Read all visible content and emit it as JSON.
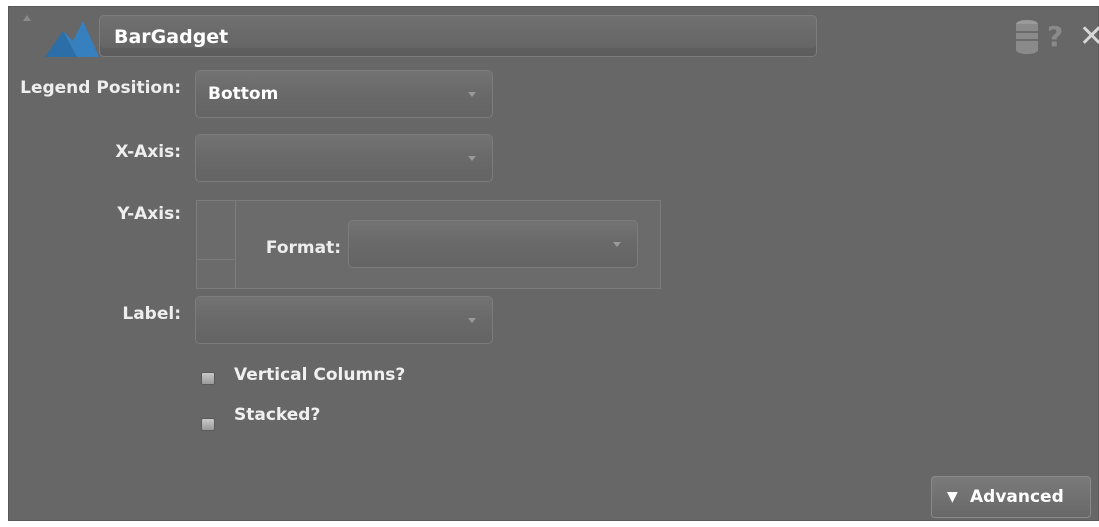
{
  "gadget": {
    "title": "BarGadget",
    "help_symbol": "?",
    "close_symbol": "✕",
    "icons": {
      "logo": "bar-chart-logo",
      "database": "database-icon",
      "help": "help-icon",
      "close": "close-icon",
      "collapse": "collapse-arrow-icon"
    }
  },
  "form": {
    "legend_position": {
      "label": "Legend Position:",
      "value": "Bottom"
    },
    "x_axis": {
      "label": "X-Axis:",
      "value": ""
    },
    "y_axis": {
      "label": "Y-Axis:",
      "format_label": "Format:",
      "format_value": ""
    },
    "label": {
      "label": "Label:",
      "value": ""
    },
    "vertical_columns": {
      "label": "Vertical Columns?",
      "checked": false
    },
    "stacked": {
      "label": "Stacked?",
      "checked": false
    }
  },
  "footer": {
    "advanced_label": "Advanced",
    "advanced_icon": "chevron-down-icon"
  },
  "colors": {
    "panel_bg": "#676767",
    "text": "#ffffff",
    "logo": "#2b6ea8"
  }
}
